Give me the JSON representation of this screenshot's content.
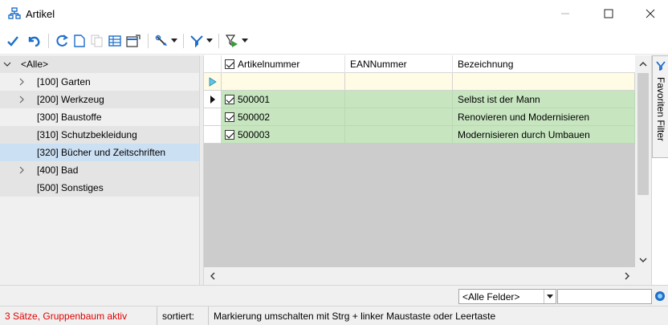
{
  "window": {
    "title": "Artikel"
  },
  "toolbar": {
    "icons": [
      "check-icon",
      "undo-icon",
      "refresh-icon",
      "new-document-icon",
      "copy-document-icon",
      "table-view-icon",
      "properties-icon",
      "tools-icon",
      "filter-icon",
      "filter-run-icon"
    ]
  },
  "tree": {
    "items": [
      {
        "label": "<Alle>",
        "expander": "expanded"
      },
      {
        "label": "[100] Garten",
        "expander": "collapsed"
      },
      {
        "label": "[200] Werkzeug",
        "expander": "collapsed"
      },
      {
        "label": "[300] Baustoffe",
        "expander": "none"
      },
      {
        "label": "[310] Schutzbekleidung",
        "expander": "none"
      },
      {
        "label": "[320] Bücher und Zeitschriften",
        "expander": "none",
        "selected": true
      },
      {
        "label": "[400] Bad",
        "expander": "collapsed"
      },
      {
        "label": "[500] Sonstiges",
        "expander": "none"
      }
    ]
  },
  "grid": {
    "columns": [
      "Artikelnummer",
      "EANNummer",
      "Bezeichnung"
    ],
    "rows": [
      {
        "artikelnummer": "500001",
        "ean": "",
        "bezeichnung": "Selbst ist der Mann",
        "checked": true,
        "current": true
      },
      {
        "artikelnummer": "500002",
        "ean": "",
        "bezeichnung": "Renovieren und Modernisieren",
        "checked": true
      },
      {
        "artikelnummer": "500003",
        "ean": "",
        "bezeichnung": "Modernisieren durch Umbauen",
        "checked": true
      }
    ]
  },
  "sidepanel": {
    "tab_label": "Favoriten Filter"
  },
  "search": {
    "field_selected": "<Alle Felder>",
    "value": ""
  },
  "status": {
    "records": "3 Sätze, Gruppenbaum aktiv",
    "sort": "sortiert:",
    "hint": "Markierung umschalten mit Strg + linker Maustaste oder Leertaste"
  },
  "colors": {
    "row_green": "#c7e6c0",
    "new_row": "#fffbe4",
    "tree_selected": "#cce0f4",
    "status_alert": "#e00000",
    "icon_blue": "#1e6fc9"
  }
}
